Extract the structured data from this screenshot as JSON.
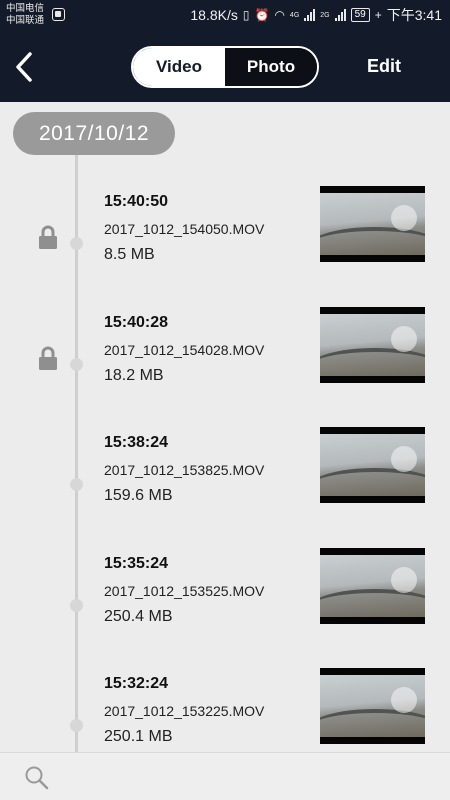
{
  "status_bar": {
    "carrier_1": "中国电信",
    "carrier_2": "中国联通",
    "speed": "18.8K/s",
    "net_1": "4G",
    "net_2": "2G",
    "net_3": "2G",
    "battery": "59",
    "time": "下午3:41"
  },
  "header": {
    "back_icon": "chevron-left-icon",
    "tabs": [
      {
        "label": "Video",
        "active": false
      },
      {
        "label": "Photo",
        "active": true
      }
    ],
    "edit_label": "Edit"
  },
  "timeline": {
    "date": "2017/10/12",
    "items": [
      {
        "time": "15:40:50",
        "filename": "2017_1012_154050.MOV",
        "size": "8.5 MB",
        "locked": true
      },
      {
        "time": "15:40:28",
        "filename": "2017_1012_154028.MOV",
        "size": "18.2 MB",
        "locked": true
      },
      {
        "time": "15:38:24",
        "filename": "2017_1012_153825.MOV",
        "size": "159.6 MB",
        "locked": false
      },
      {
        "time": "15:35:24",
        "filename": "2017_1012_153525.MOV",
        "size": "250.4 MB",
        "locked": false
      },
      {
        "time": "15:32:24",
        "filename": "2017_1012_153225.MOV",
        "size": "250.1 MB",
        "locked": false
      }
    ]
  },
  "bottom_bar": {
    "search_icon": "search-icon"
  },
  "colors": {
    "header_bg": "#131b2a",
    "content_bg": "#ececec",
    "date_pill": "#9a9a9a"
  }
}
